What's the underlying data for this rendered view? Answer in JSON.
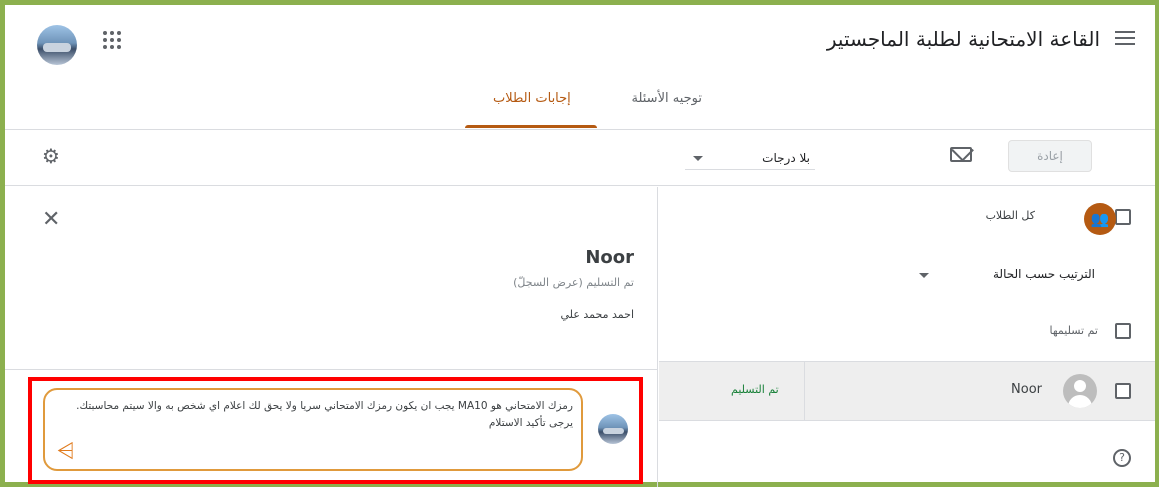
{
  "header": {
    "title": "القاعة الامتحانية لطلبة الماجستير",
    "tabs": [
      {
        "label": "توجيه الأسئلة"
      },
      {
        "label": "إجابات الطلاب"
      }
    ],
    "accent_color": "#b55a12"
  },
  "toolbar": {
    "return_label": "إعادة",
    "grade_select_value": "بلا درجات"
  },
  "detail": {
    "student_name": "Noor",
    "status_line": "تم التسليم (عرض السجلّ)",
    "submitter": "احمد محمد علي",
    "comment_text": "رمزك الامتحاني هو MA10 يجب ان يكون رمزك الامتحاني سريا ولا يحق لك اعلام اي شخص به والا سيتم محاسبتك. يرجى تأكيد الاستلام"
  },
  "list": {
    "all_students_label": "كل الطلاب",
    "sort_label": "الترتيب حسب الحالة",
    "section_label": "تم تسليمها",
    "rows": [
      {
        "name": "Noor",
        "status": "تم التسليم"
      }
    ]
  },
  "colors": {
    "frame": "#8cb04e",
    "highlight_box": "#ff0000",
    "comment_border": "#e09a3c",
    "status_green": "#188038"
  },
  "icons": [
    "menu-icon",
    "apps-icon",
    "settings-icon",
    "mail-icon",
    "close-icon",
    "send-icon",
    "help-icon",
    "group-icon"
  ]
}
